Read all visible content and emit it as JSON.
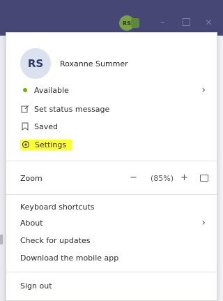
{
  "titlebar": {
    "avatar_initials": "RS",
    "minimize_glyph": "–",
    "close_glyph": "×"
  },
  "profile": {
    "initials": "RS",
    "name": "Roxanne Summer"
  },
  "status_menu": {
    "available": "Available",
    "set_status": "Set status message",
    "saved": "Saved",
    "settings": "Settings"
  },
  "zoom": {
    "label": "Zoom",
    "minus": "−",
    "value": "(85%)",
    "plus": "+"
  },
  "info_menu": {
    "keyboard_shortcuts": "Keyboard shortcuts",
    "about": "About",
    "check_updates": "Check for updates",
    "download_mobile": "Download the mobile app"
  },
  "sign_out": "Sign out",
  "chevron": "›",
  "colors": {
    "titlebar": "#464775",
    "available_dot": "#6bb700",
    "highlight": "#ffff33",
    "avatar_bg": "#dbe1ef"
  },
  "icons": [
    "presence-dot-icon",
    "edit-status-icon",
    "bookmark-icon",
    "gear-icon",
    "chevron-right-icon",
    "fit-to-window-icon"
  ]
}
